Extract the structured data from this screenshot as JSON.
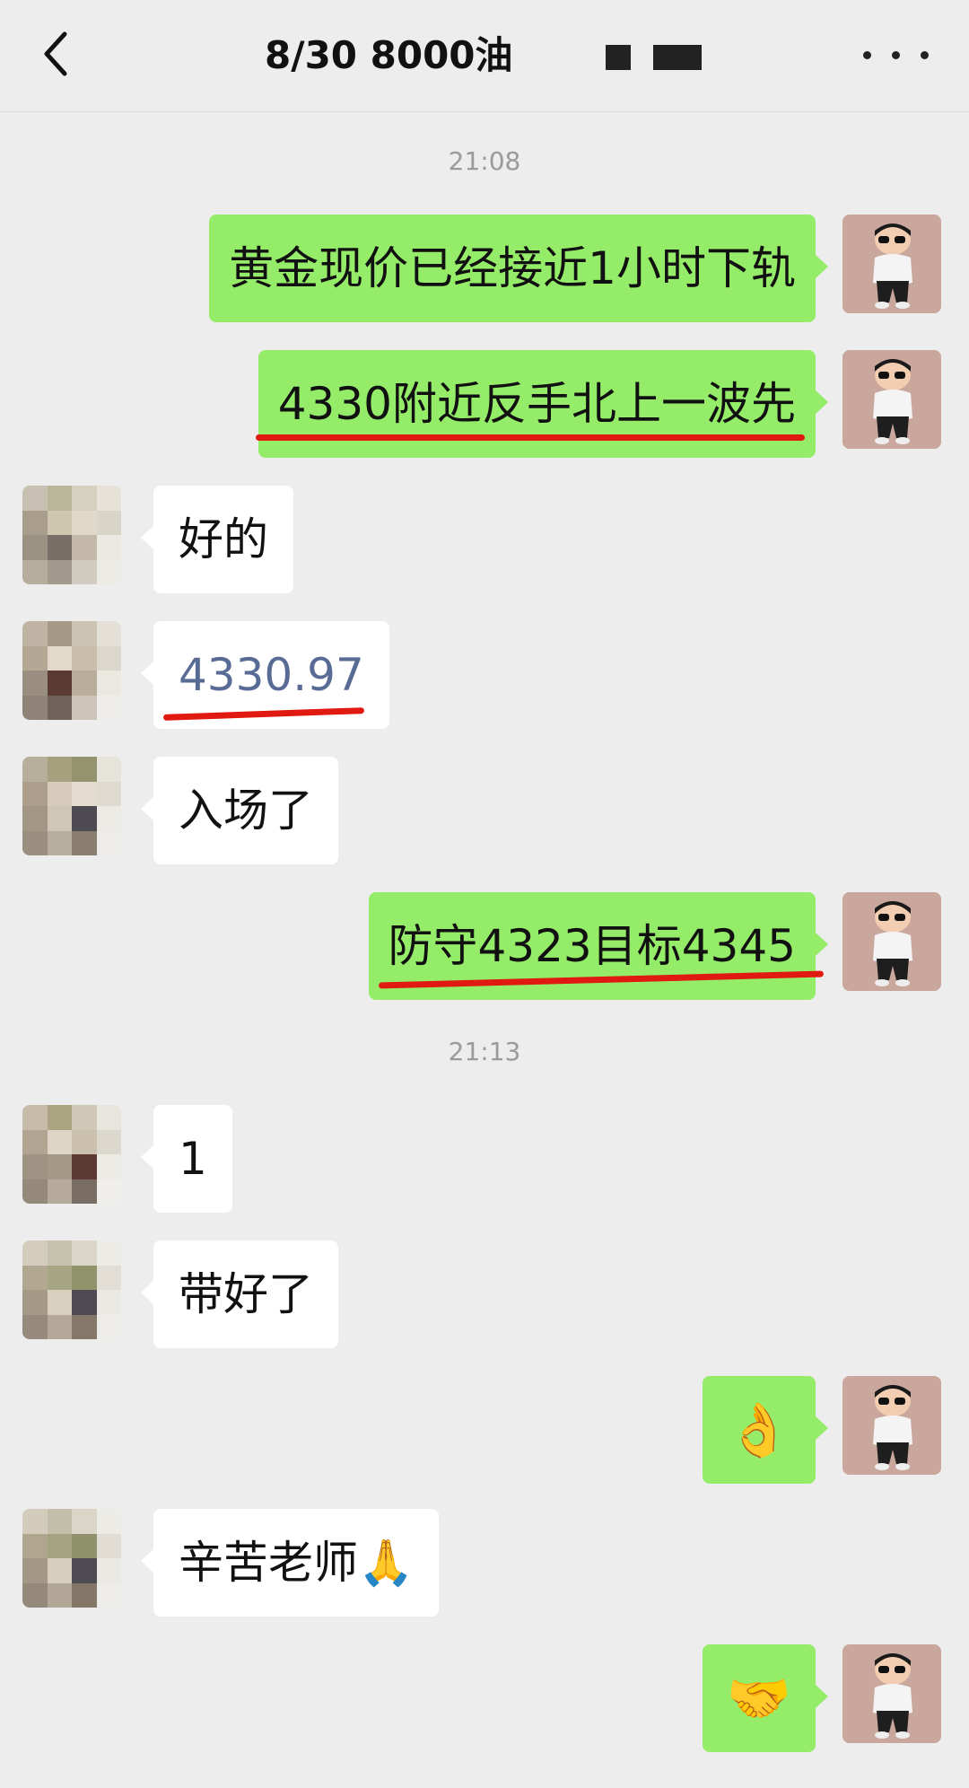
{
  "header": {
    "title": "8/30  8000油",
    "back_icon": "chevron-left-icon",
    "more_icon": "more-dots-icon"
  },
  "colors": {
    "background": "#ededed",
    "self_bubble": "#95ec69",
    "other_bubble": "#ffffff",
    "link_text": "#576b95",
    "underline": "#e01a10"
  },
  "timestamps": [
    "21:08",
    "21:13"
  ],
  "messages": [
    {
      "sender": "self",
      "text": "黄金现价已经接近1小时下轨"
    },
    {
      "sender": "self",
      "text": "4330附近反手北上一波先"
    },
    {
      "sender": "other",
      "text": "好的"
    },
    {
      "sender": "other",
      "text": "4330.97"
    },
    {
      "sender": "other",
      "text": "入场了"
    },
    {
      "sender": "self",
      "text": "防守4323目标4345"
    },
    {
      "sender": "other",
      "text": "1"
    },
    {
      "sender": "other",
      "text": "带好了"
    },
    {
      "sender": "self",
      "text": "👌"
    },
    {
      "sender": "other",
      "text": "辛苦老师🙏"
    },
    {
      "sender": "self",
      "text": "🤝"
    }
  ]
}
